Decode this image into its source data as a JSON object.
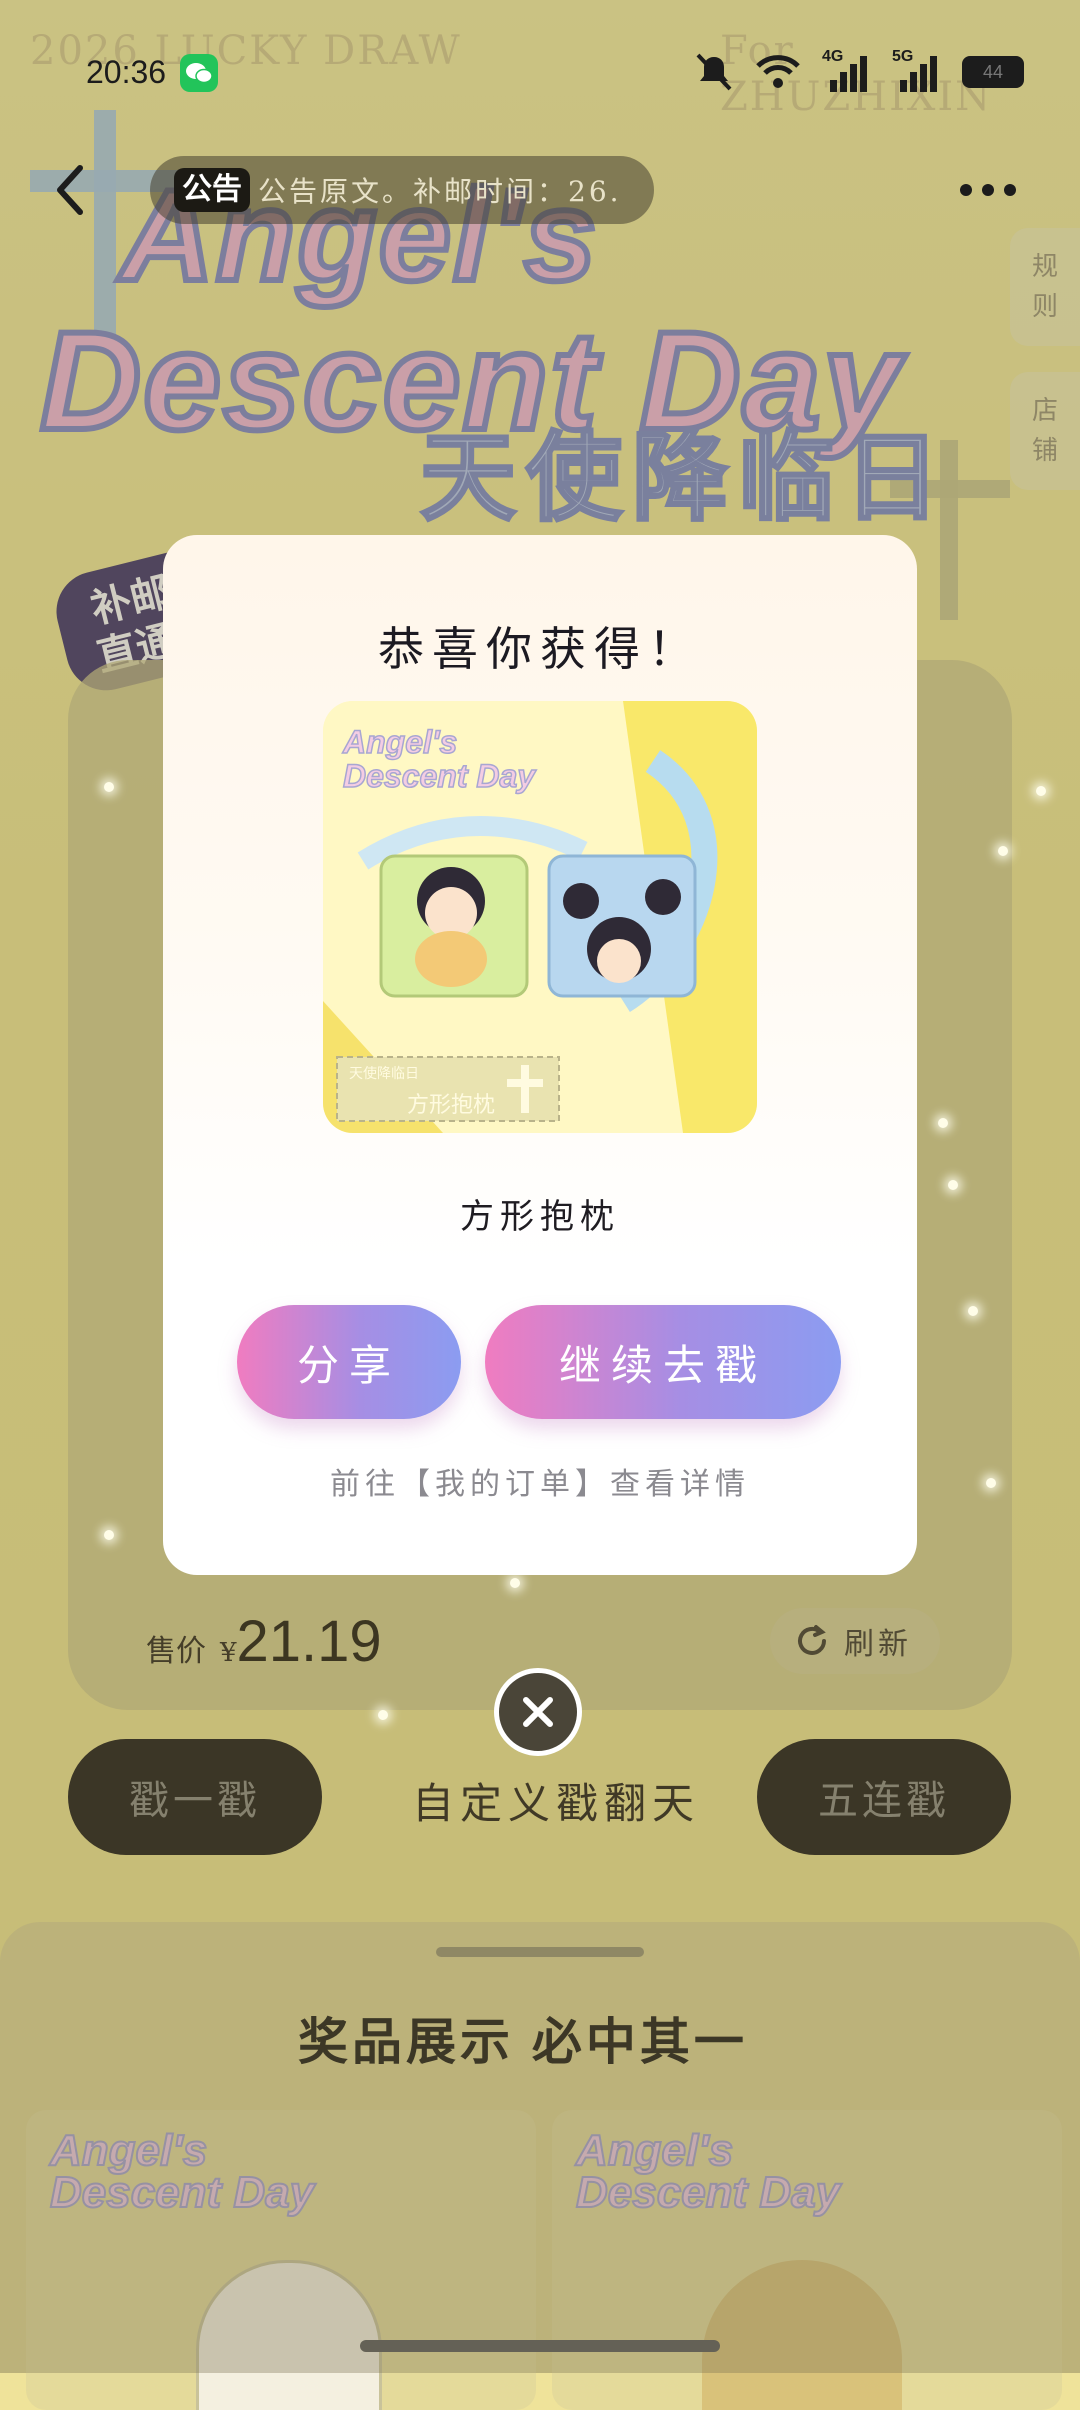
{
  "status_bar": {
    "time": "20:36",
    "icons": [
      "wechat-icon",
      "mute-icon",
      "wifi-icon",
      "4g-signal-icon",
      "5g-signal-icon",
      "battery-icon"
    ],
    "signal_4g": "4G",
    "signal_5g": "5G",
    "battery": "44"
  },
  "background": {
    "watermark_left": "2026 LUCKY DRAW",
    "watermark_right": "For ZHUZHIXIN",
    "banner_line1": "Angel's",
    "banner_line2": "Descent Day",
    "banner_cn": "天使降临日",
    "badge_line1": "补邮",
    "badge_line2": "直通",
    "price_label": "售价",
    "currency": "¥",
    "price": "21.19",
    "refresh_label": "刷新",
    "draw_one": "戳一戳",
    "custom_draw": "自定义戳翻天",
    "draw_five": "五连戳",
    "prizes_title": "奖品展示 必中其一",
    "card_text_1": "Angel's",
    "card_text_2": "Descent Day"
  },
  "nav": {
    "notice_tag": "公告",
    "notice_text": "公告原文。补邮时间：26.",
    "more_icon": "more-dots-icon",
    "side_tab_rules": [
      "规",
      "则"
    ],
    "side_tab_shop": [
      "店",
      "铺"
    ]
  },
  "modal": {
    "title": "恭喜你获得！",
    "prize_name": "方形抱枕",
    "prize_image_text_1": "Angel's",
    "prize_image_text_2": "Descent Day",
    "prize_image_caption": "天使降临日",
    "prize_image_caption_2": "方形抱枕",
    "share_label": "分享",
    "continue_label": "继续去戳",
    "hint": "前往【我的订单】查看详情"
  },
  "colors": {
    "button_gradient_start": "#f07cc0",
    "button_gradient_end": "#8b9cf1",
    "background_yellow": "#f3e98f"
  }
}
